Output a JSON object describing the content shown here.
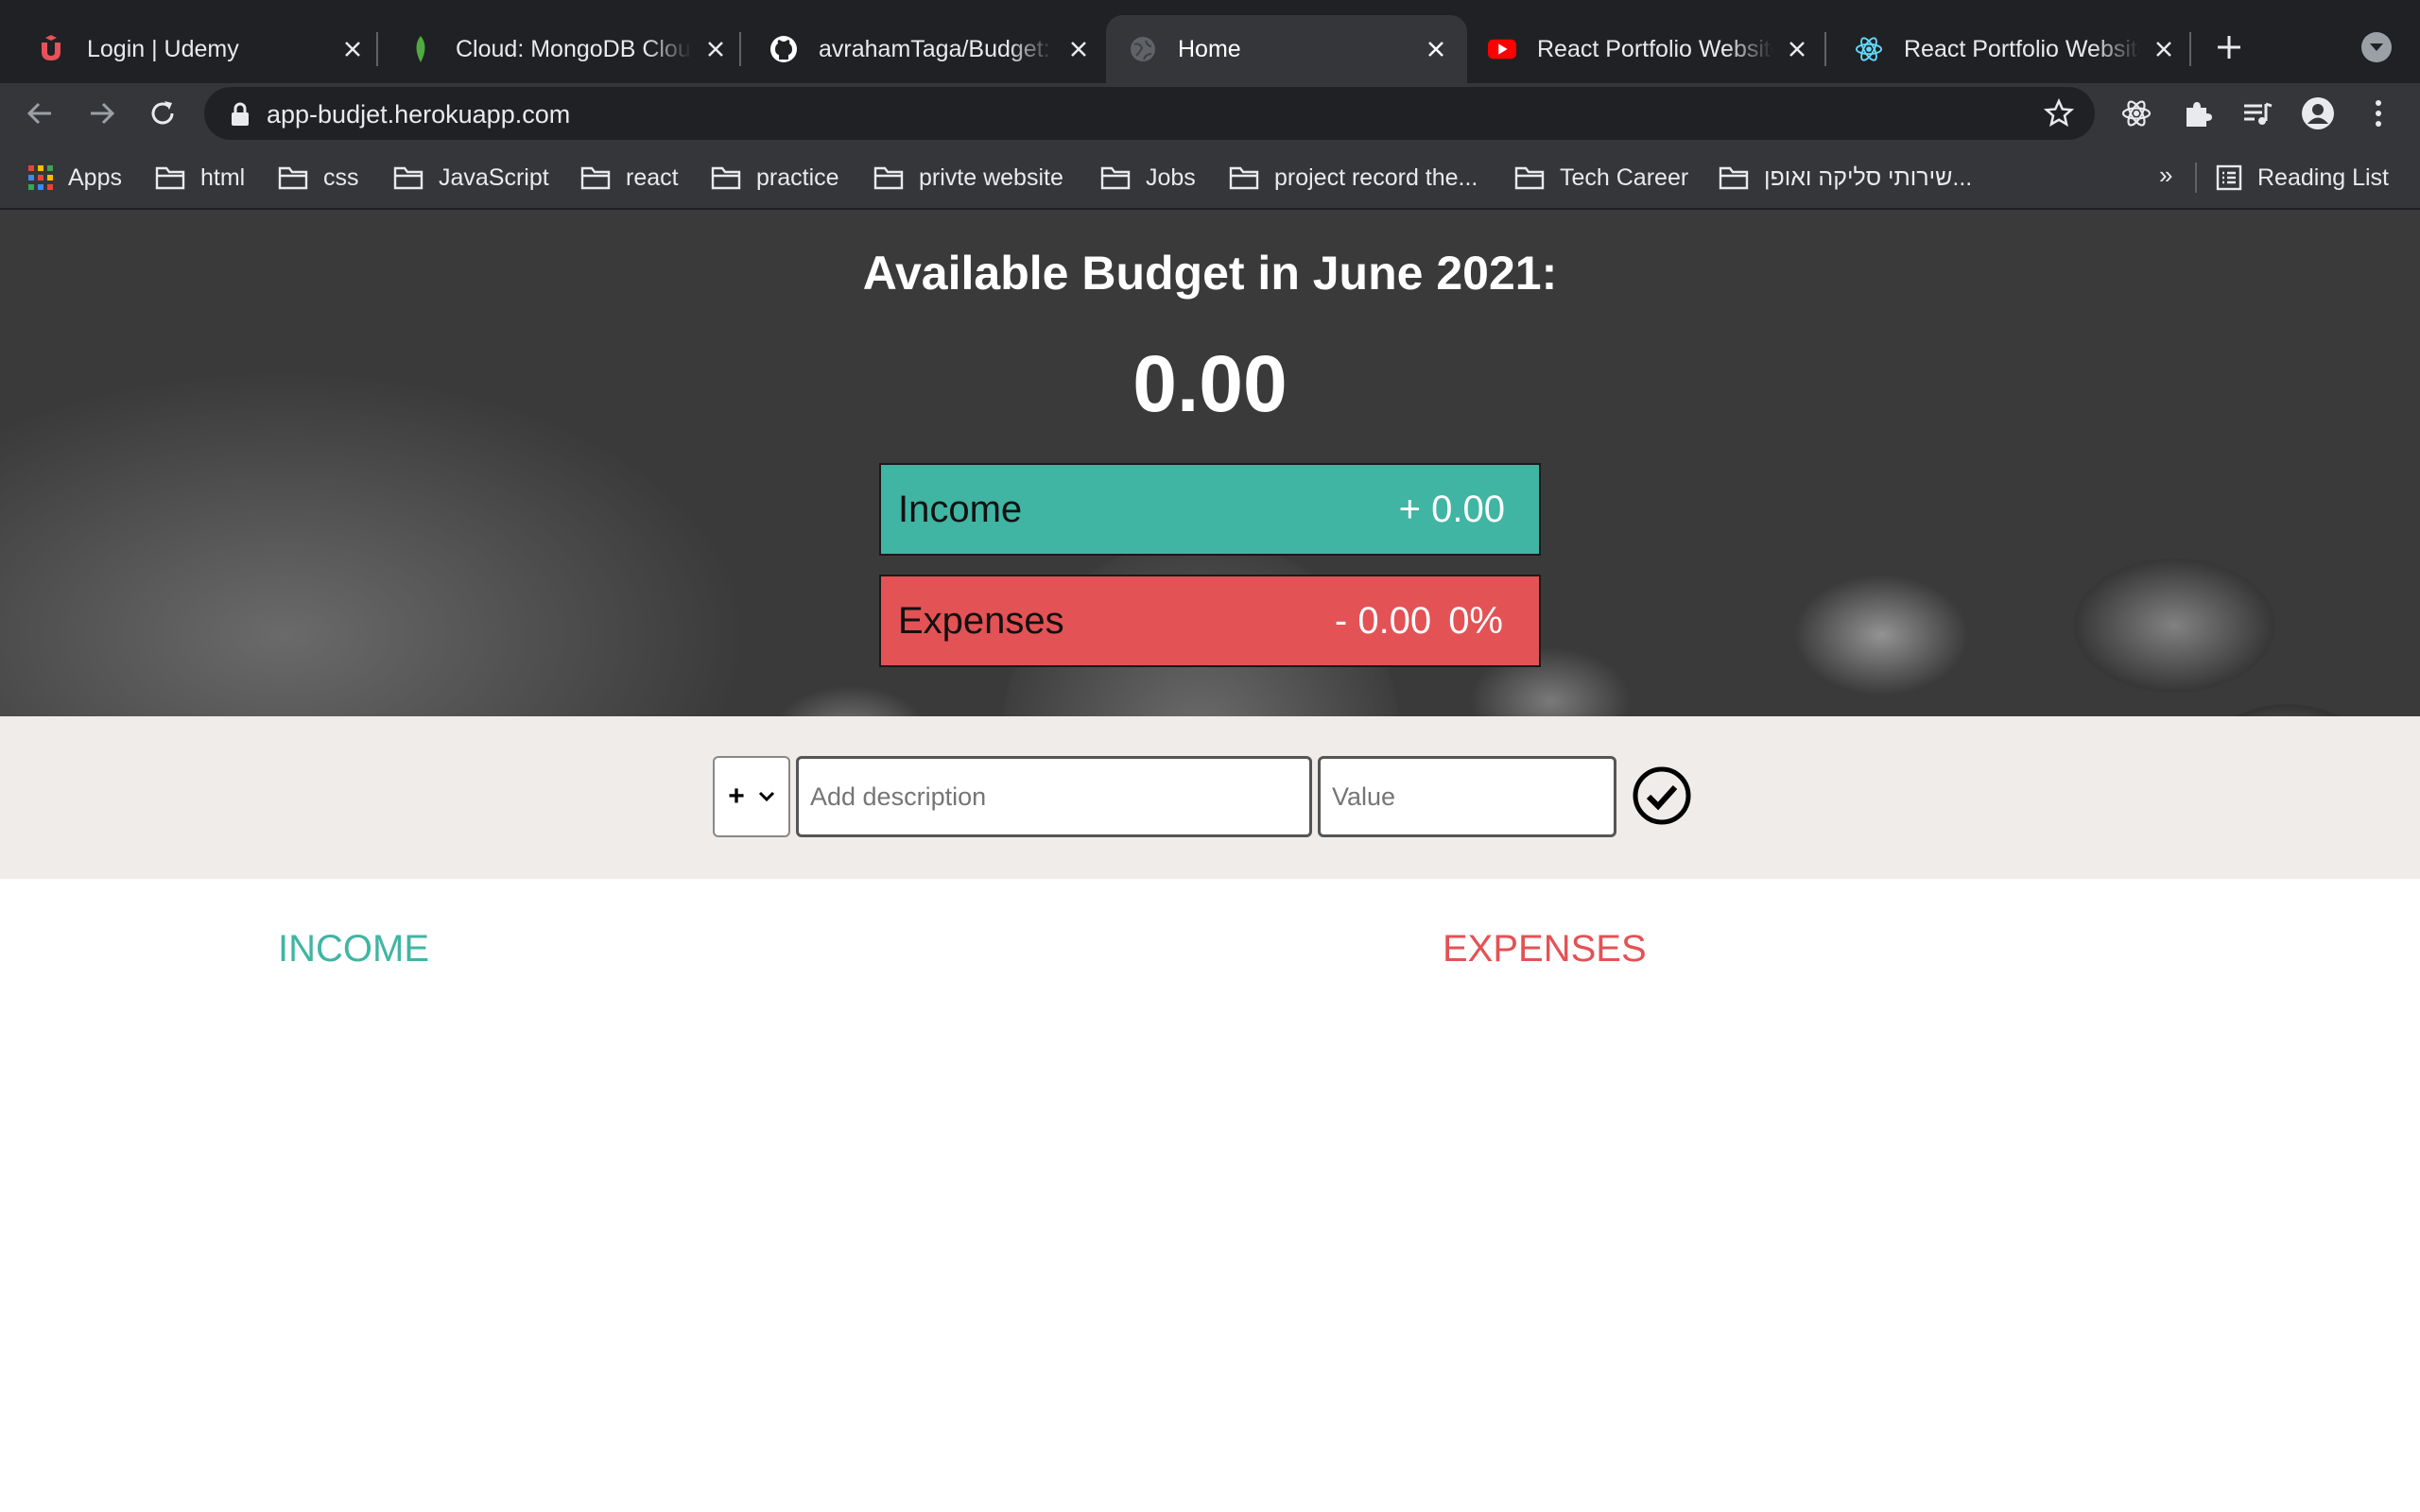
{
  "browser": {
    "tabs": [
      {
        "title": "Login | Udemy",
        "favicon": "udemy-icon",
        "active": false
      },
      {
        "title": "Cloud: MongoDB Cloud",
        "favicon": "mongodb-leaf-icon",
        "active": false
      },
      {
        "title": "avrahamTaga/Budget: A",
        "favicon": "github-icon",
        "active": false
      },
      {
        "title": "Home",
        "favicon": "globe-icon",
        "active": true
      },
      {
        "title": "React Portfolio Website",
        "favicon": "youtube-icon",
        "active": false
      },
      {
        "title": "React Portfolio Website",
        "favicon": "react-icon",
        "active": false
      }
    ],
    "url": "app-budjet.herokuapp.com",
    "bookmarks": [
      {
        "label": "Apps",
        "icon": "apps-grid-icon"
      },
      {
        "label": "html",
        "icon": "folder-icon"
      },
      {
        "label": "css",
        "icon": "folder-icon"
      },
      {
        "label": "JavaScript",
        "icon": "folder-icon"
      },
      {
        "label": "react",
        "icon": "folder-icon"
      },
      {
        "label": "practice",
        "icon": "folder-icon"
      },
      {
        "label": "privte website",
        "icon": "folder-icon"
      },
      {
        "label": "Jobs",
        "icon": "folder-icon"
      },
      {
        "label": "project record the...",
        "icon": "folder-icon"
      },
      {
        "label": "Tech Career",
        "icon": "folder-icon"
      },
      {
        "label": "שירותי סליקה ואופן...",
        "icon": "folder-icon"
      }
    ],
    "bookmarks_overflow": "»",
    "reading_list": "Reading List"
  },
  "budget": {
    "title": "Available Budget in June 2021:",
    "total": "0.00",
    "income_label": "Income",
    "income_value": "+ 0.00",
    "expenses_label": "Expenses",
    "expenses_value": "- 0.00",
    "expenses_percentage": "0%"
  },
  "form": {
    "type_selected": "+",
    "description_placeholder": "Add description",
    "value_placeholder": "Value"
  },
  "lists": {
    "income_title": "INCOME",
    "expenses_title": "EXPENSES"
  },
  "colors": {
    "income": "#40b5a3",
    "expenses": "#e35255",
    "chrome_dark": "#202124",
    "chrome_toolbar": "#35363a"
  }
}
